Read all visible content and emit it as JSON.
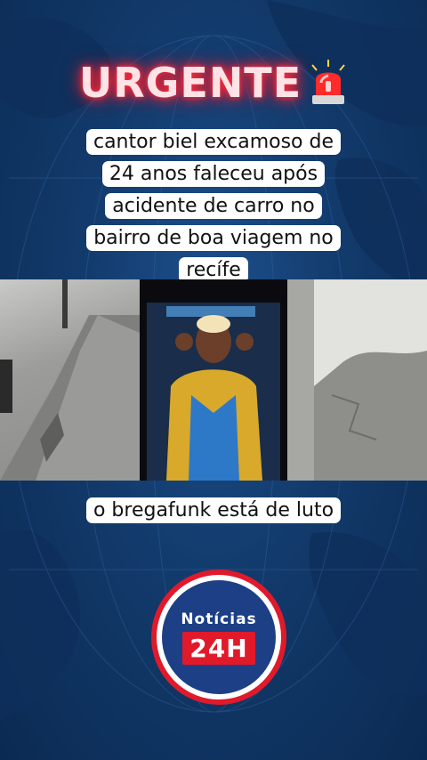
{
  "headline": {
    "text": "URGENTE",
    "icon": "siren-icon"
  },
  "caption_top": "cantor biel excamoso de 24 anos faleceu após acidente de carro no bairro de boa viagem no recífe",
  "caption_bottom": "o bregafunk está de luto",
  "logo": {
    "title": "Notícias",
    "badge": "24H"
  },
  "colors": {
    "background": "#123a6b",
    "accent_red": "#e01a2b",
    "logo_blue": "#1c3f86"
  }
}
